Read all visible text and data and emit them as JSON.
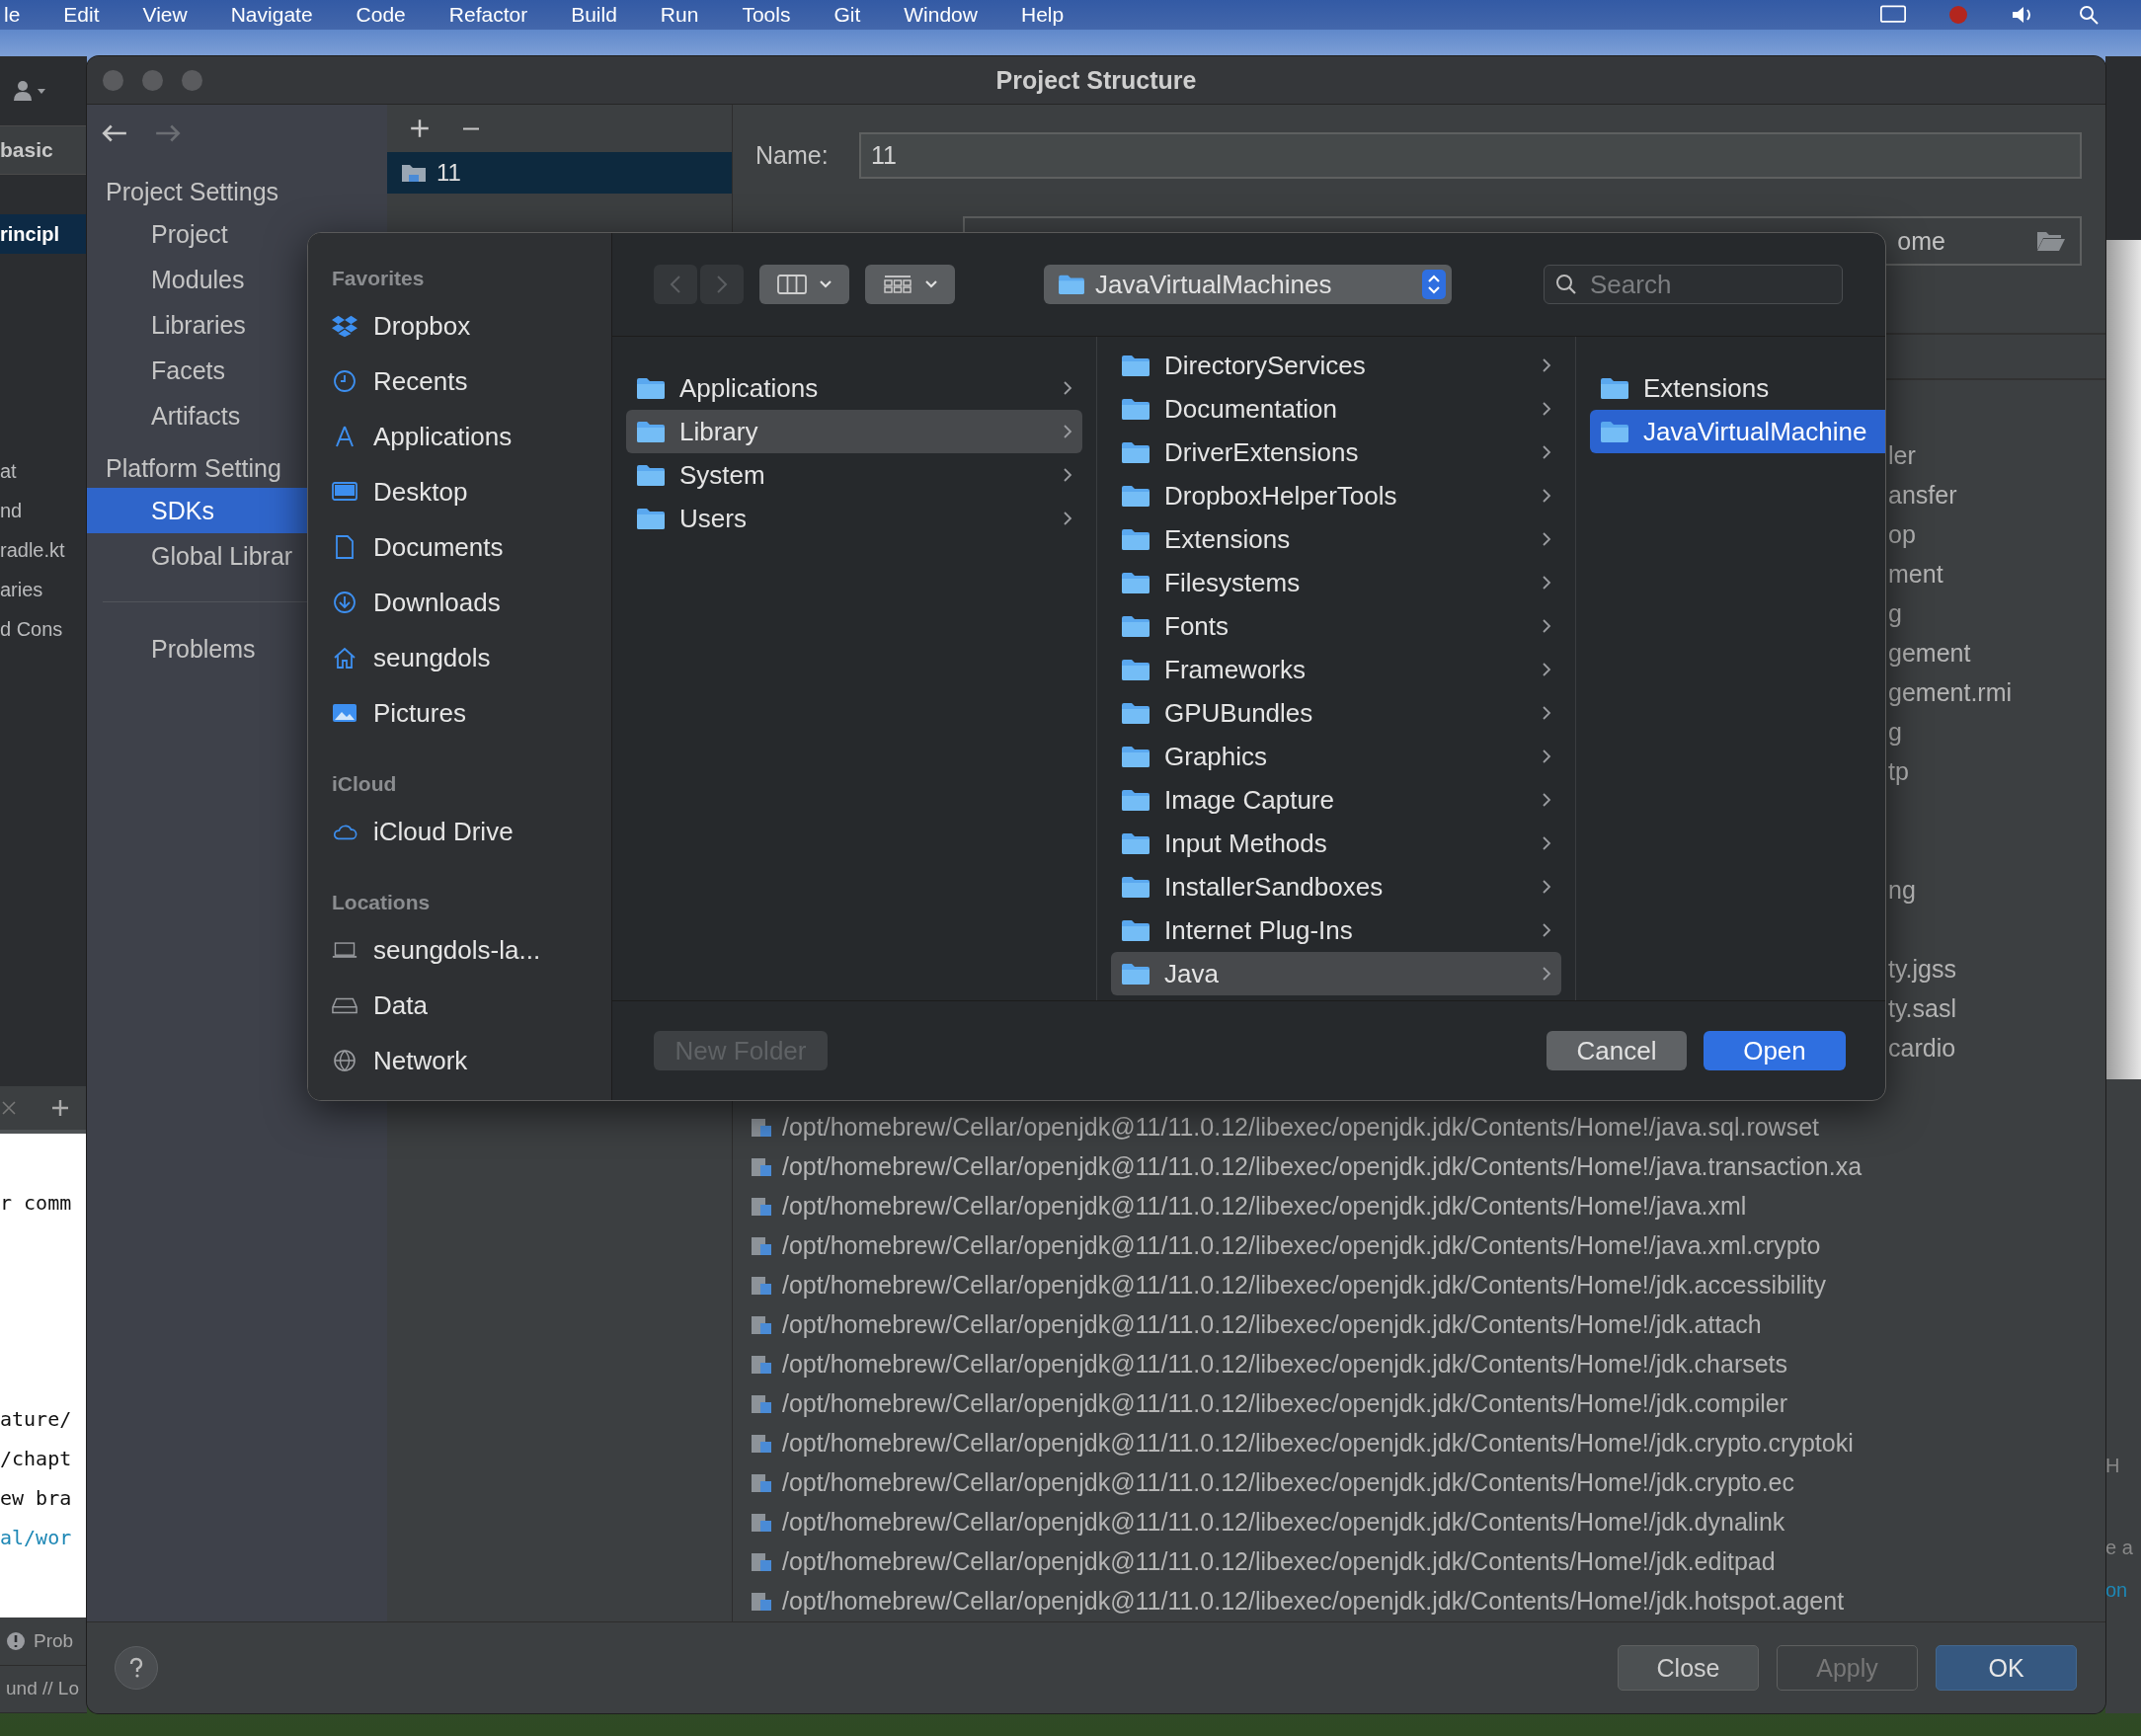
{
  "menu_bar": {
    "items": [
      "le",
      "Edit",
      "View",
      "Navigate",
      "Code",
      "Refactor",
      "Build",
      "Run",
      "Tools",
      "Git",
      "Window",
      "Help"
    ]
  },
  "ide_left": {
    "breadcrumb": "basic",
    "tree_top": [
      {
        "label": "rincipl",
        "selected": true
      }
    ],
    "tree": [
      "at",
      "nd",
      "radle.kt",
      "aries",
      "d Cons"
    ],
    "editor_top": [
      "r comm"
    ],
    "editor": [
      {
        "text": "ature/",
        "kind": "code"
      },
      {
        "text": "/chapt",
        "kind": "code"
      },
      {
        "text": "ew bra",
        "kind": "code"
      },
      {
        "text": "al/wor",
        "kind": "link"
      }
    ],
    "status": [
      "Prob",
      "und // Lo"
    ]
  },
  "ide_right": {
    "texts": [
      {
        "text": "H",
        "kind": "plain"
      },
      {
        "text": "e a",
        "kind": "plain"
      },
      {
        "text": "on",
        "kind": "link"
      }
    ]
  },
  "window": {
    "title": "Project Structure"
  },
  "nav": {
    "back_disabled": false,
    "forward_disabled": true,
    "items": [
      {
        "label": "Project Settings",
        "kind": "header"
      },
      {
        "label": "Project",
        "kind": "item",
        "selected": false
      },
      {
        "label": "Modules",
        "kind": "item",
        "selected": false
      },
      {
        "label": "Libraries",
        "kind": "item",
        "selected": false
      },
      {
        "label": "Facets",
        "kind": "item",
        "selected": false
      },
      {
        "label": "Artifacts",
        "kind": "item",
        "selected": false
      },
      {
        "label": "Platform Setting",
        "kind": "header"
      },
      {
        "label": "SDKs",
        "kind": "item",
        "selected": true
      },
      {
        "label": "Global Librar",
        "kind": "item",
        "selected": false
      },
      {
        "kind": "separator"
      },
      {
        "label": "Problems",
        "kind": "item",
        "selected": false
      }
    ]
  },
  "sdk_list": {
    "items": [
      {
        "label": "11",
        "selected": true
      }
    ]
  },
  "sdk_detail": {
    "name_label": "Name:",
    "name_value": "11",
    "home_path_value": "ome",
    "covered_rows": [
      "ler",
      "ansfer",
      "op",
      "ment",
      "g",
      "gement",
      "gement.rmi",
      "g",
      "tp",
      null,
      null,
      "ng",
      null,
      "ty.jgss",
      "ty.sasl",
      "cardio",
      null
    ],
    "rows": [
      "/opt/homebrew/Cellar/openjdk@11/11.0.12/libexec/openjdk.jdk/Contents/Home!/java.sql.rowset",
      "/opt/homebrew/Cellar/openjdk@11/11.0.12/libexec/openjdk.jdk/Contents/Home!/java.transaction.xa",
      "/opt/homebrew/Cellar/openjdk@11/11.0.12/libexec/openjdk.jdk/Contents/Home!/java.xml",
      "/opt/homebrew/Cellar/openjdk@11/11.0.12/libexec/openjdk.jdk/Contents/Home!/java.xml.crypto",
      "/opt/homebrew/Cellar/openjdk@11/11.0.12/libexec/openjdk.jdk/Contents/Home!/jdk.accessibility",
      "/opt/homebrew/Cellar/openjdk@11/11.0.12/libexec/openjdk.jdk/Contents/Home!/jdk.attach",
      "/opt/homebrew/Cellar/openjdk@11/11.0.12/libexec/openjdk.jdk/Contents/Home!/jdk.charsets",
      "/opt/homebrew/Cellar/openjdk@11/11.0.12/libexec/openjdk.jdk/Contents/Home!/jdk.compiler",
      "/opt/homebrew/Cellar/openjdk@11/11.0.12/libexec/openjdk.jdk/Contents/Home!/jdk.crypto.cryptoki",
      "/opt/homebrew/Cellar/openjdk@11/11.0.12/libexec/openjdk.jdk/Contents/Home!/jdk.crypto.ec",
      "/opt/homebrew/Cellar/openjdk@11/11.0.12/libexec/openjdk.jdk/Contents/Home!/jdk.dynalink",
      "/opt/homebrew/Cellar/openjdk@11/11.0.12/libexec/openjdk.jdk/Contents/Home!/jdk.editpad",
      "/opt/homebrew/Cellar/openjdk@11/11.0.12/libexec/openjdk.jdk/Contents/Home!/jdk.hotspot.agent"
    ]
  },
  "buttons": [
    {
      "label": "Close",
      "kind": "default",
      "disabled": false
    },
    {
      "label": "Apply",
      "kind": "default",
      "disabled": true
    },
    {
      "label": "OK",
      "kind": "primary",
      "disabled": false
    }
  ],
  "file_dialog": {
    "sidebar": [
      {
        "header": "Favorites",
        "items": [
          "Dropbox",
          "Recents",
          "Applications",
          "Desktop",
          "Documents",
          "Downloads",
          "seungdols",
          "Pictures"
        ]
      },
      {
        "header": "iCloud",
        "items": [
          "iCloud Drive"
        ]
      },
      {
        "header": "Locations",
        "items": [
          "seungdols-la...",
          "Data",
          "Network"
        ]
      }
    ],
    "back_disabled": true,
    "forward_disabled": true,
    "path_popup": "JavaVirtualMachines",
    "search_placeholder": "Search",
    "columns": [
      {
        "focused": false,
        "scrolled": false,
        "items": [
          {
            "label": "Applications",
            "selected": false,
            "has_children": true
          },
          {
            "label": "Library",
            "selected": true,
            "has_children": true
          },
          {
            "label": "System",
            "selected": false,
            "has_children": true
          },
          {
            "label": "Users",
            "selected": false,
            "has_children": true
          }
        ]
      },
      {
        "focused": false,
        "scrolled": true,
        "items": [
          {
            "label": "DirectoryServices",
            "selected": false,
            "has_children": true
          },
          {
            "label": "Documentation",
            "selected": false,
            "has_children": true
          },
          {
            "label": "DriverExtensions",
            "selected": false,
            "has_children": true
          },
          {
            "label": "DropboxHelperTools",
            "selected": false,
            "has_children": true
          },
          {
            "label": "Extensions",
            "selected": false,
            "has_children": true
          },
          {
            "label": "Filesystems",
            "selected": false,
            "has_children": true
          },
          {
            "label": "Fonts",
            "selected": false,
            "has_children": true
          },
          {
            "label": "Frameworks",
            "selected": false,
            "has_children": true
          },
          {
            "label": "GPUBundles",
            "selected": false,
            "has_children": true
          },
          {
            "label": "Graphics",
            "selected": false,
            "has_children": true
          },
          {
            "label": "Image Capture",
            "selected": false,
            "has_children": true
          },
          {
            "label": "Input Methods",
            "selected": false,
            "has_children": true
          },
          {
            "label": "InstallerSandboxes",
            "selected": false,
            "has_children": true
          },
          {
            "label": "Internet Plug-Ins",
            "selected": false,
            "has_children": true
          },
          {
            "label": "Java",
            "selected": true,
            "has_children": true
          }
        ]
      },
      {
        "focused": true,
        "scrolled": false,
        "items": [
          {
            "label": "Extensions",
            "selected": false,
            "has_children": false
          },
          {
            "label": "JavaVirtualMachine",
            "selected": true,
            "has_children": false
          }
        ]
      }
    ],
    "new_folder": {
      "label": "New Folder",
      "disabled": true
    },
    "cancel": "Cancel",
    "open": "Open"
  }
}
